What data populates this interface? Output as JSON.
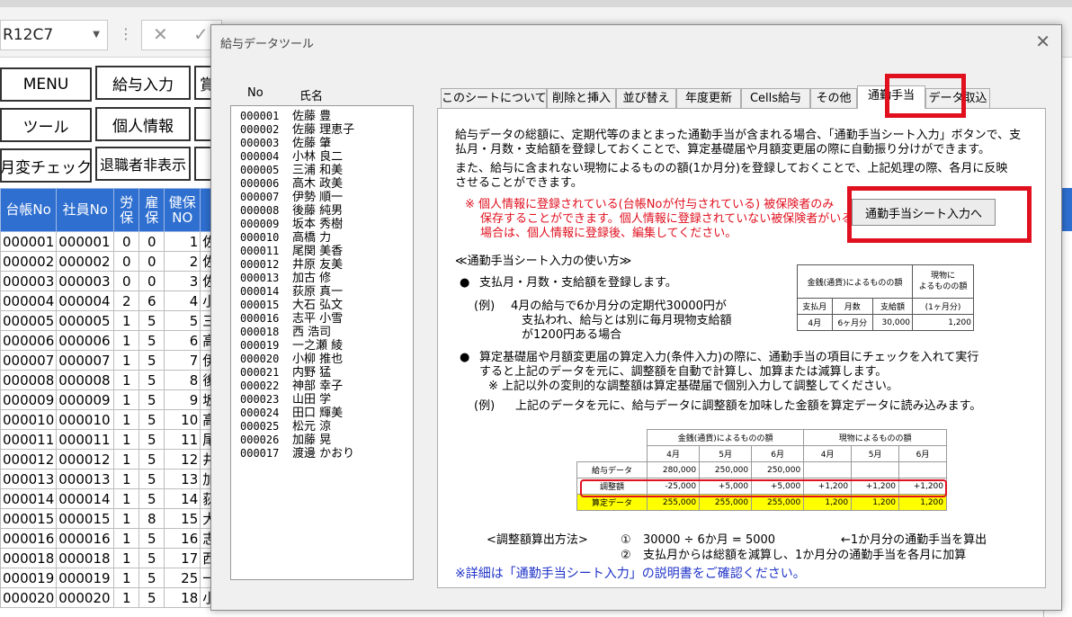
{
  "excel": {
    "name_box": "R12C7",
    "buttons": [
      {
        "label": "MENU"
      },
      {
        "label": "給与入力"
      },
      {
        "label": "賞"
      },
      {
        "label": "ツール"
      },
      {
        "label": "個人情報"
      },
      {
        "label": ""
      },
      {
        "label": "月変チェック"
      },
      {
        "label": "退職者非表示"
      },
      {
        "label": ""
      }
    ],
    "headers": [
      "台帳No",
      "社員No",
      "労保",
      "雇保",
      "健保NO",
      ""
    ],
    "rows": [
      {
        "daicho": "000001",
        "shain": "000001",
        "rou": "0",
        "koyo": "0",
        "kenpo": "1",
        "name": "佐"
      },
      {
        "daicho": "000002",
        "shain": "000002",
        "rou": "0",
        "koyo": "0",
        "kenpo": "2",
        "name": "佐"
      },
      {
        "daicho": "000003",
        "shain": "000003",
        "rou": "0",
        "koyo": "0",
        "kenpo": "3",
        "name": "佐"
      },
      {
        "daicho": "000004",
        "shain": "000004",
        "rou": "2",
        "koyo": "6",
        "kenpo": "4",
        "name": "小"
      },
      {
        "daicho": "000005",
        "shain": "000005",
        "rou": "1",
        "koyo": "5",
        "kenpo": "5",
        "name": "三"
      },
      {
        "daicho": "000006",
        "shain": "000006",
        "rou": "1",
        "koyo": "5",
        "kenpo": "6",
        "name": "高"
      },
      {
        "daicho": "000007",
        "shain": "000007",
        "rou": "1",
        "koyo": "5",
        "kenpo": "7",
        "name": "伊"
      },
      {
        "daicho": "000008",
        "shain": "000008",
        "rou": "1",
        "koyo": "5",
        "kenpo": "8",
        "name": "後"
      },
      {
        "daicho": "000009",
        "shain": "000009",
        "rou": "1",
        "koyo": "5",
        "kenpo": "9",
        "name": "坂"
      },
      {
        "daicho": "000010",
        "shain": "000010",
        "rou": "1",
        "koyo": "5",
        "kenpo": "10",
        "name": "高"
      },
      {
        "daicho": "000011",
        "shain": "000011",
        "rou": "1",
        "koyo": "5",
        "kenpo": "11",
        "name": "尾"
      },
      {
        "daicho": "000012",
        "shain": "000012",
        "rou": "1",
        "koyo": "5",
        "kenpo": "12",
        "name": "井"
      },
      {
        "daicho": "000013",
        "shain": "000013",
        "rou": "1",
        "koyo": "5",
        "kenpo": "13",
        "name": "加"
      },
      {
        "daicho": "000014",
        "shain": "000014",
        "rou": "1",
        "koyo": "5",
        "kenpo": "14",
        "name": "荻"
      },
      {
        "daicho": "000015",
        "shain": "000015",
        "rou": "1",
        "koyo": "8",
        "kenpo": "15",
        "name": "大"
      },
      {
        "daicho": "000016",
        "shain": "000016",
        "rou": "1",
        "koyo": "5",
        "kenpo": "16",
        "name": "志"
      },
      {
        "daicho": "000018",
        "shain": "000018",
        "rou": "1",
        "koyo": "5",
        "kenpo": "17",
        "name": "西"
      },
      {
        "daicho": "000019",
        "shain": "000019",
        "rou": "1",
        "koyo": "5",
        "kenpo": "25",
        "name": "一"
      },
      {
        "daicho": "000020",
        "shain": "000020",
        "rou": "1",
        "koyo": "5",
        "kenpo": "18",
        "name": "小"
      }
    ]
  },
  "dialog": {
    "title": "給与データツール",
    "col_no": "No",
    "col_name": "氏名",
    "employees": [
      {
        "no": "000001",
        "name": "佐藤 豊"
      },
      {
        "no": "000002",
        "name": "佐藤 理恵子"
      },
      {
        "no": "000003",
        "name": "佐藤 肇"
      },
      {
        "no": "000004",
        "name": "小林 良二"
      },
      {
        "no": "000005",
        "name": "三浦 和美"
      },
      {
        "no": "000006",
        "name": "高木 政美"
      },
      {
        "no": "000007",
        "name": "伊勢 順一"
      },
      {
        "no": "000008",
        "name": "後藤 純男"
      },
      {
        "no": "000009",
        "name": "坂本 秀樹"
      },
      {
        "no": "000010",
        "name": "高橋 力"
      },
      {
        "no": "000011",
        "name": "尾関 美香"
      },
      {
        "no": "000012",
        "name": "井原 友美"
      },
      {
        "no": "000013",
        "name": "加古 修"
      },
      {
        "no": "000014",
        "name": "荻原 真一"
      },
      {
        "no": "000015",
        "name": "大石 弘文"
      },
      {
        "no": "000016",
        "name": "志平 小雪"
      },
      {
        "no": "000018",
        "name": "西 浩司"
      },
      {
        "no": "000019",
        "name": "一之瀬 綾"
      },
      {
        "no": "000020",
        "name": "小柳 推也"
      },
      {
        "no": "000021",
        "name": "内野 猛"
      },
      {
        "no": "000022",
        "name": "神部 幸子"
      },
      {
        "no": "000023",
        "name": "山田 学"
      },
      {
        "no": "000024",
        "name": "田口 輝美"
      },
      {
        "no": "000025",
        "name": "松元 涼"
      },
      {
        "no": "000026",
        "name": "加藤 晃"
      },
      {
        "no": "000017",
        "name": "渡邊 かおり"
      }
    ],
    "tabs": [
      {
        "label": "このシートについて"
      },
      {
        "label": "削除と挿入"
      },
      {
        "label": "並び替え"
      },
      {
        "label": "年度更新"
      },
      {
        "label": "Cells給与"
      },
      {
        "label": "その他"
      },
      {
        "label": "通勤手当"
      },
      {
        "label": "データ取込"
      }
    ],
    "panel": {
      "intro1a": "給与データの総額に、定期代等のまとまった通勤手当が含まれる場合、「通勤手当シート入力」ボタンで、支",
      "intro1b": "払月・月数・支給額を登録しておくことで、算定基礎届や月額変更届の際に自動振り分けができます。",
      "intro2a": "また、給与に含まれない現物によるものの額(1か月分)を登録しておくことで、上記処理の際、各月に反映",
      "intro2b": "させることができます。",
      "warn1": "※ 個人情報に登録されている(台帳Noが付与されている) 被保険者のみ",
      "warn2": "保存することができます。個人情報に登録されていない被保険者がいる",
      "warn3": "場合は、個人情報に登録後、編集してください。",
      "button": "通勤手当シート入力へ",
      "howto_title": "≪通勤手当シート入力の使い方≫",
      "bullet_glyph": "●",
      "bullet1": "支払月・月数・支給額を登録します。",
      "ex1_label": "(例)",
      "ex1a": "4月の給与で6か月分の定期代30000円が",
      "ex1b": "支払われ、給与とは別に毎月現物支給額",
      "ex1c": "が1200円ある場合",
      "mini": {
        "h1": "金銭(通貨)によるものの額",
        "h2a": "現物に",
        "h2b": "よるものの額",
        "c1": "支払月",
        "c2": "月数",
        "c3": "支給額",
        "c4": "(1ヶ月分)",
        "v1": "4月",
        "v2": "6ヶ月分",
        "v3": "30,000",
        "v4": "1,200"
      },
      "bullet2a": "算定基礎届や月額変更届の算定入力(条件入力)の際に、通勤手当の項目にチェックを入れて実行",
      "bullet2b": "すると上記のデータを元に、調整額を自動で計算し、加算または減算します。",
      "bullet2c": "※ 上記以外の変則的な調整額は算定基礎届で個別入力して調整してください。",
      "ex2_label": "(例)",
      "ex2": "上記のデータを元に、給与データに調整額を加味した金額を算定データに読み込みます。",
      "calc": {
        "g1": "金銭(通貨)によるものの額",
        "g2": "現物によるものの額",
        "months": [
          "4月",
          "5月",
          "6月",
          "4月",
          "5月",
          "6月"
        ],
        "rows": [
          {
            "label": "給与データ",
            "values": [
              "280,000",
              "250,000",
              "250,000",
              "",
              "",
              ""
            ]
          },
          {
            "label": "調整額",
            "values": [
              "-25,000",
              "+5,000",
              "+5,000",
              "+1,200",
              "+1,200",
              "+1,200"
            ]
          },
          {
            "label": "算定データ",
            "values": [
              "255,000",
              "255,000",
              "255,000",
              "1,200",
              "1,200",
              "1,200"
            ]
          }
        ]
      },
      "method_label": "<調整額算出方法>",
      "m1_num": "①",
      "m1": "30000 ÷ 6か月 = 5000",
      "m1_note": "←1か月分の通勤手当を算出",
      "m2_num": "②",
      "m2": "支払月からは総額を減算し、1か月分の通勤手当を各月に加算",
      "footnote": "※詳細は「通勤手当シート入力」の説明書をご確認ください。"
    }
  }
}
